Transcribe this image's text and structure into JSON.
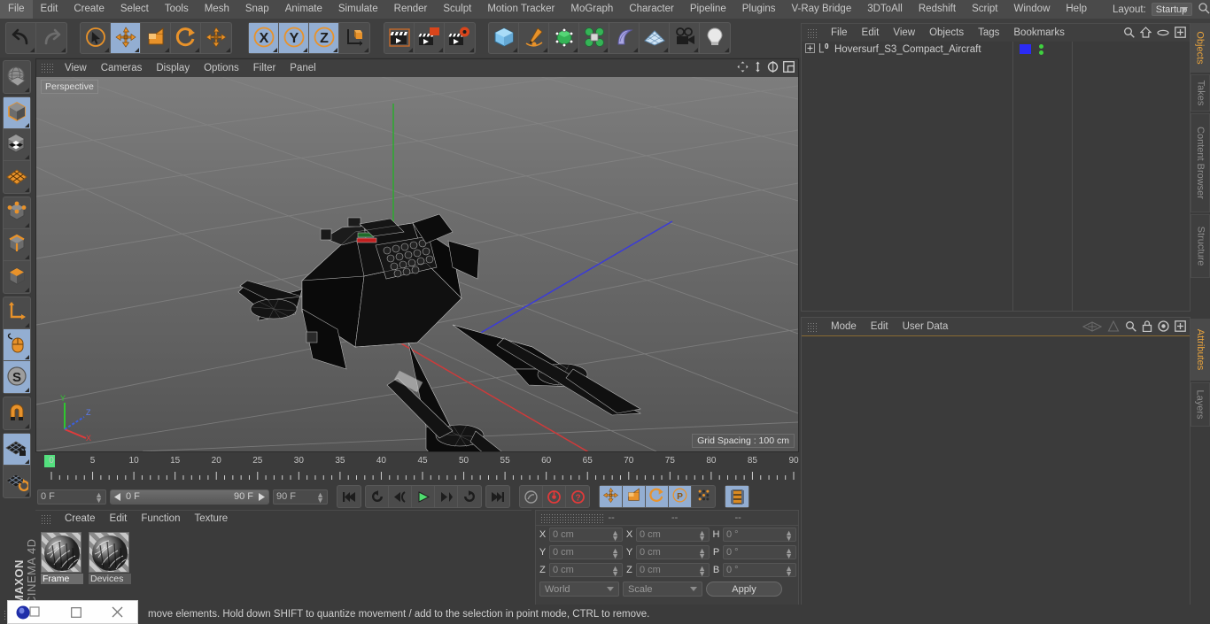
{
  "app": {
    "name": "MAXON",
    "product": "CINEMA 4D"
  },
  "menubar": {
    "items": [
      "File",
      "Edit",
      "Create",
      "Select",
      "Tools",
      "Mesh",
      "Snap",
      "Animate",
      "Simulate",
      "Render",
      "Sculpt",
      "Motion Tracker",
      "MoGraph",
      "Character",
      "Pipeline",
      "Plugins",
      "V-Ray Bridge",
      "3DToAll",
      "Redshift",
      "Script",
      "Window",
      "Help"
    ],
    "layout_label": "Layout:",
    "layout_value": "Startup",
    "search_icon": "magnifier-icon"
  },
  "toolbar": {
    "groups": [
      {
        "name": "undo-redo",
        "buttons": [
          {
            "name": "undo",
            "icon": "undo-arrow-icon",
            "selected": false
          },
          {
            "name": "redo",
            "icon": "redo-arrow-icon",
            "selected": false
          }
        ]
      },
      {
        "name": "transform-tools",
        "buttons": [
          {
            "name": "live-selection",
            "icon": "cursor-circle-icon",
            "selected": false
          },
          {
            "name": "move",
            "icon": "move-cross-icon",
            "selected": true
          },
          {
            "name": "scale",
            "icon": "scale-box-icon",
            "selected": false
          },
          {
            "name": "rotate",
            "icon": "rotate-arc-icon",
            "selected": false
          },
          {
            "name": "move-duplicate",
            "icon": "move-cross-icon",
            "selected": false
          }
        ]
      },
      {
        "name": "axis-locks",
        "buttons": [
          {
            "name": "lock-x",
            "icon": "x-axis-icon",
            "selected": true
          },
          {
            "name": "lock-y",
            "icon": "y-axis-icon",
            "selected": true
          },
          {
            "name": "lock-z",
            "icon": "z-axis-icon",
            "selected": true
          },
          {
            "name": "world-object-coords",
            "icon": "world-axis-cube-icon",
            "selected": false
          }
        ]
      },
      {
        "name": "render-tools",
        "buttons": [
          {
            "name": "render-view",
            "icon": "clapper-icon",
            "selected": false
          },
          {
            "name": "render-region",
            "icon": "clapper-region-icon",
            "selected": false
          },
          {
            "name": "render-settings",
            "icon": "clapper-gear-icon",
            "selected": false
          }
        ]
      },
      {
        "name": "create-objects",
        "buttons": [
          {
            "name": "add-cube",
            "icon": "blue-cube-icon",
            "selected": false
          },
          {
            "name": "add-spline",
            "icon": "pen-spline-icon",
            "selected": false
          },
          {
            "name": "add-generator",
            "icon": "green-cube-nurbs-icon",
            "selected": false
          },
          {
            "name": "add-array",
            "icon": "green-cluster-icon",
            "selected": false
          },
          {
            "name": "add-deformer",
            "icon": "purple-bend-icon",
            "selected": false
          },
          {
            "name": "add-scene-floor",
            "icon": "grid-plane-icon",
            "selected": false
          },
          {
            "name": "add-camera",
            "icon": "camera-icon",
            "selected": false
          },
          {
            "name": "add-light",
            "icon": "lightbulb-icon",
            "selected": false
          }
        ]
      }
    ]
  },
  "leftbar": {
    "groups": [
      {
        "name": "view-globe",
        "buttons": [
          {
            "name": "make-editable-globe",
            "icon": "globe-wire-icon",
            "selected": false
          }
        ]
      },
      {
        "name": "mode-object",
        "buttons": [
          {
            "name": "model-mode",
            "icon": "grey-cube-icon",
            "selected": true
          },
          {
            "name": "texture-mode",
            "icon": "checker-cube-icon",
            "selected": false
          },
          {
            "name": "deformer-mode",
            "icon": "orange-lattice-icon",
            "selected": false
          }
        ]
      },
      {
        "name": "component-modes",
        "buttons": [
          {
            "name": "point-mode",
            "icon": "point-cube-icon",
            "selected": false
          },
          {
            "name": "edge-mode",
            "icon": "edge-cube-icon",
            "selected": false
          },
          {
            "name": "polygon-mode",
            "icon": "polygon-cube-icon",
            "selected": false
          }
        ]
      },
      {
        "name": "axis-and-snap",
        "buttons": [
          {
            "name": "enable-axis-modification",
            "icon": "axis-l-icon",
            "selected": false
          },
          {
            "name": "viewport-solo",
            "icon": "mouse-icon",
            "selected": true
          },
          {
            "name": "snap-settings",
            "icon": "s-disc-icon",
            "selected": true
          }
        ]
      },
      {
        "name": "magnet",
        "buttons": [
          {
            "name": "magnet-tool",
            "icon": "magnet-icon",
            "selected": false
          }
        ]
      },
      {
        "name": "workplane",
        "buttons": [
          {
            "name": "lock-workplane",
            "icon": "workplane-lock-icon",
            "selected": true
          },
          {
            "name": "align-workplane",
            "icon": "workplane-rotate-icon",
            "selected": false
          }
        ]
      }
    ]
  },
  "viewport": {
    "menu": [
      "View",
      "Cameras",
      "Display",
      "Options",
      "Filter",
      "Panel"
    ],
    "nav_icons": [
      "pan-icon",
      "dolly-icon",
      "rotate-icon",
      "maximize-icon"
    ],
    "label": "Perspective",
    "grid_spacing": "Grid Spacing : 100 cm",
    "axis": {
      "x": "X",
      "y": "Y",
      "z": "Z"
    },
    "scene_object": "Hoversurf_S3_Compact_Aircraft"
  },
  "timeline": {
    "ticks": [
      "0",
      "5",
      "10",
      "15",
      "20",
      "25",
      "30",
      "35",
      "40",
      "45",
      "50",
      "55",
      "60",
      "65",
      "70",
      "75",
      "80",
      "85",
      "90"
    ],
    "current_frame": "0 F",
    "range_start": "0 F",
    "range_end": "90 F",
    "end_frame": "90 F",
    "preview_frame": "0 F",
    "transport": [
      {
        "name": "go-to-start",
        "icon": "skip-start-icon"
      },
      {
        "name": "play-reverse-loop",
        "icon": "loop-reverse-icon"
      },
      {
        "name": "step-back",
        "icon": "step-back-icon"
      },
      {
        "name": "play",
        "icon": "play-icon"
      },
      {
        "name": "step-forward",
        "icon": "step-forward-icon"
      },
      {
        "name": "play-forward-loop",
        "icon": "loop-forward-icon"
      },
      {
        "name": "go-to-end",
        "icon": "skip-end-icon"
      }
    ],
    "record_group": [
      {
        "name": "autokey",
        "icon": "key-icon"
      },
      {
        "name": "record-active-objects",
        "icon": "record-red-icon"
      },
      {
        "name": "record-question",
        "icon": "question-red-icon"
      }
    ],
    "key_group": [
      {
        "name": "key-position",
        "icon": "move-cross-icon",
        "selected": true
      },
      {
        "name": "key-scale",
        "icon": "scale-box-icon",
        "selected": true
      },
      {
        "name": "key-rotation",
        "icon": "rotate-arc-icon",
        "selected": true
      },
      {
        "name": "key-parameter",
        "icon": "p-circle-icon",
        "selected": true
      },
      {
        "name": "key-pla",
        "icon": "dots-grid-icon",
        "selected": false
      }
    ],
    "filmstrip": {
      "name": "timeline-filmstrip",
      "icon": "filmstrip-icon",
      "selected": true
    }
  },
  "material_manager": {
    "menu": [
      "Create",
      "Edit",
      "Function",
      "Texture"
    ],
    "materials": [
      {
        "name": "Frame",
        "selected": true
      },
      {
        "name": "Devices",
        "selected": false
      }
    ]
  },
  "coordinates": {
    "headers": [
      "--",
      "--",
      "--"
    ],
    "rows": [
      {
        "label_a": "X",
        "value_a": "0 cm",
        "label_b": "X",
        "value_b": "0 cm",
        "label_c": "H",
        "value_c": "0 °"
      },
      {
        "label_a": "Y",
        "value_a": "0 cm",
        "label_b": "Y",
        "value_b": "0 cm",
        "label_c": "P",
        "value_c": "0 °"
      },
      {
        "label_a": "Z",
        "value_a": "0 cm",
        "label_b": "Z",
        "value_b": "0 cm",
        "label_c": "B",
        "value_c": "0 °"
      }
    ],
    "system": "World",
    "mode": "Scale",
    "apply": "Apply"
  },
  "object_manager": {
    "menu": [
      "File",
      "Edit",
      "View",
      "Objects",
      "Tags",
      "Bookmarks"
    ],
    "icons": [
      "search-icon",
      "home-icon",
      "ellipse-icon",
      "fit-icon"
    ],
    "objects": [
      {
        "name": "Hoversurf_S3_Compact_Aircraft",
        "layer_color": "#2b2bf5",
        "visible_dots": "green"
      }
    ]
  },
  "attribute_manager": {
    "menu": [
      "Mode",
      "Edit",
      "User Data"
    ],
    "icons": [
      "eye-wire-icon",
      "cone-icon",
      "search-icon",
      "lock-icon",
      "target-icon",
      "fit-icon"
    ]
  },
  "vtabs_top": [
    {
      "label": "Objects",
      "active": true
    },
    {
      "label": "Takes",
      "active": false
    },
    {
      "label": "Content Browser",
      "active": false
    },
    {
      "label": "Structure",
      "active": false
    }
  ],
  "vtabs_bottom": [
    {
      "label": "Attributes",
      "active": true
    },
    {
      "label": "Layers",
      "active": false
    }
  ],
  "statusbar": {
    "message": "move elements. Hold down SHIFT to quantize movement / add to the selection in point mode, CTRL to remove."
  },
  "mini_window": {
    "icons": [
      "app-blue-orb-icon",
      "restore-icon",
      "maximize-icon",
      "close-icon"
    ]
  },
  "colors": {
    "accent_orange": "#e8922a",
    "selection_blue": "#93aed2",
    "panel": "#3b3b3b",
    "chrome": "#4a4a4a",
    "green_key": "#53e07e",
    "red": "#e23b3b"
  }
}
